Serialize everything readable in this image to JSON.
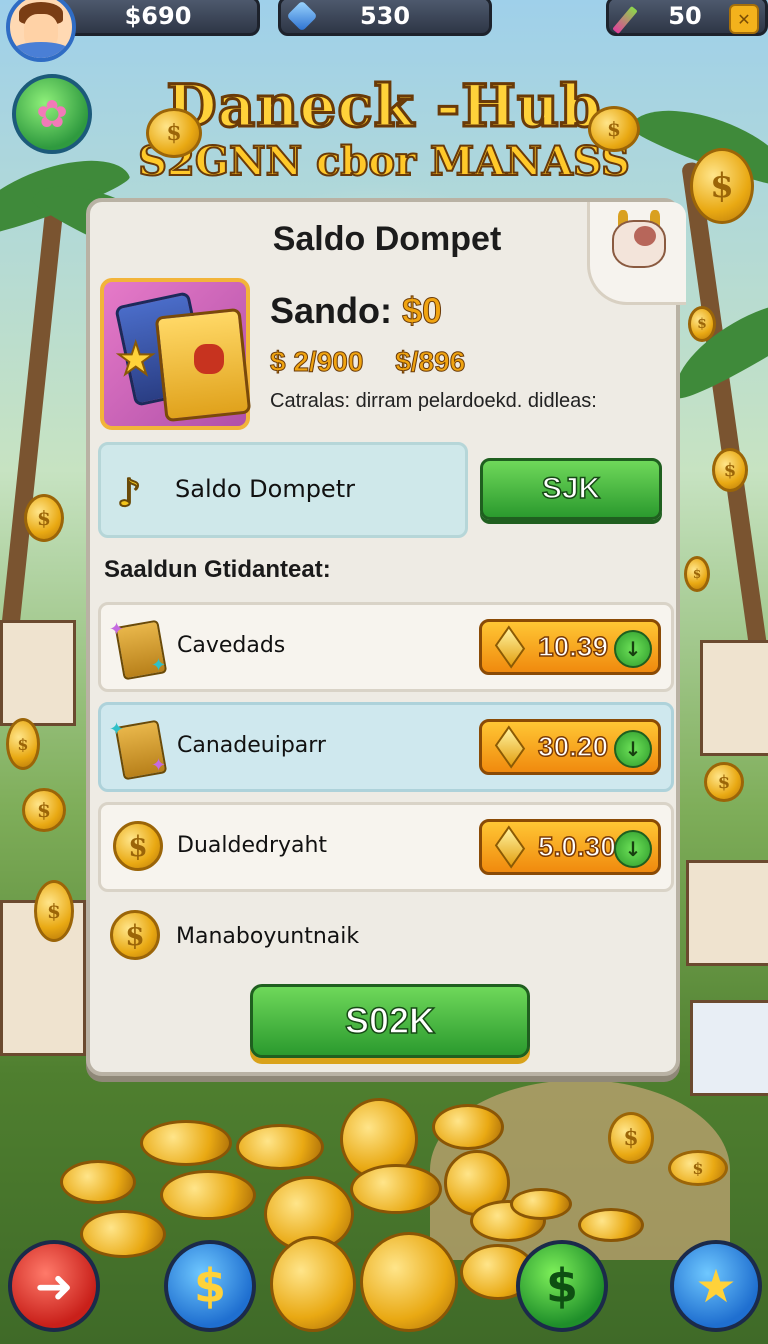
{
  "topbar": {
    "money": "$690",
    "gems": "530",
    "pencils": "50",
    "plus_icon": "close-box-icon"
  },
  "title": {
    "line1": "Daneck -Hub",
    "line2": "S2GNN cbor MANASS"
  },
  "panel": {
    "heading": "Saldo Dompet",
    "balance_label": "Sando:",
    "balance_value": "$0",
    "amount_a": "$ 2/900",
    "amount_b": "$/896",
    "description": "Catralas: dirram pelardoekd. didleas:",
    "wallet_label": "Saldo Dompetr",
    "wallet_button": "SJK",
    "section_label": "Saaldun Gtidanteat:",
    "items": [
      {
        "label": "Cavedads",
        "price": "10.39",
        "highlight": false
      },
      {
        "label": "Canadeuiparr",
        "price": "30.20",
        "highlight": true
      },
      {
        "label": "Dualdedryaht",
        "price": "5.0.30",
        "highlight": false
      }
    ],
    "last_item_label": "Manaboyuntnaik",
    "main_button": "S02K"
  },
  "colors": {
    "gold": "#f0a411",
    "green_button": "#2b9a2e",
    "orange_button": "#f08a0e",
    "panel": "#eeebe4"
  }
}
